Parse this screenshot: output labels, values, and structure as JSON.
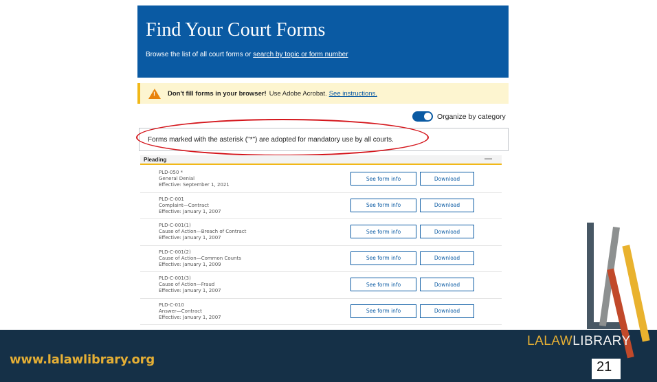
{
  "hero": {
    "title": "Find Your Court Forms",
    "subtitle_prefix": "Browse the list of all court forms or ",
    "subtitle_link": "search by topic or form number"
  },
  "warning": {
    "bold": "Don't fill forms in your browser!",
    "text": "Use Adobe Acrobat.",
    "link": "See instructions."
  },
  "toggle": {
    "label": "Organize by category",
    "on": true
  },
  "notice": "Forms marked with the asterisk (\"*\") are adopted for mandatory use by all courts.",
  "section": {
    "title": "Pleading",
    "collapse_symbol": "—"
  },
  "forms": [
    {
      "code": "PLD-050 *",
      "name": "General Denial",
      "effective": "Effective: September 1, 2021"
    },
    {
      "code": "PLD-C-001",
      "name": "Complaint—Contract",
      "effective": "Effective: January 1, 2007"
    },
    {
      "code": "PLD-C-001(1)",
      "name": "Cause of Action—Breach of Contract",
      "effective": "Effective: January 1, 2007"
    },
    {
      "code": "PLD-C-001(2)",
      "name": "Cause of Action—Common Counts",
      "effective": "Effective: January 1, 2009"
    },
    {
      "code": "PLD-C-001(3)",
      "name": "Cause of Action—Fraud",
      "effective": "Effective: January 1, 2007"
    },
    {
      "code": "PLD-C-010",
      "name": "Answer—Contract",
      "effective": "Effective: January 1, 2007"
    }
  ],
  "buttons": {
    "info": "See form info",
    "download": "Download"
  },
  "footer": {
    "url": "www.lalawlibrary.org",
    "brand_a": "LALAW",
    "brand_b": "LIBRARY",
    "page": "21"
  },
  "colors": {
    "primary": "#0a5aa3",
    "accent": "#e5af35",
    "footer": "#153047",
    "highlight": "#d4151b"
  }
}
